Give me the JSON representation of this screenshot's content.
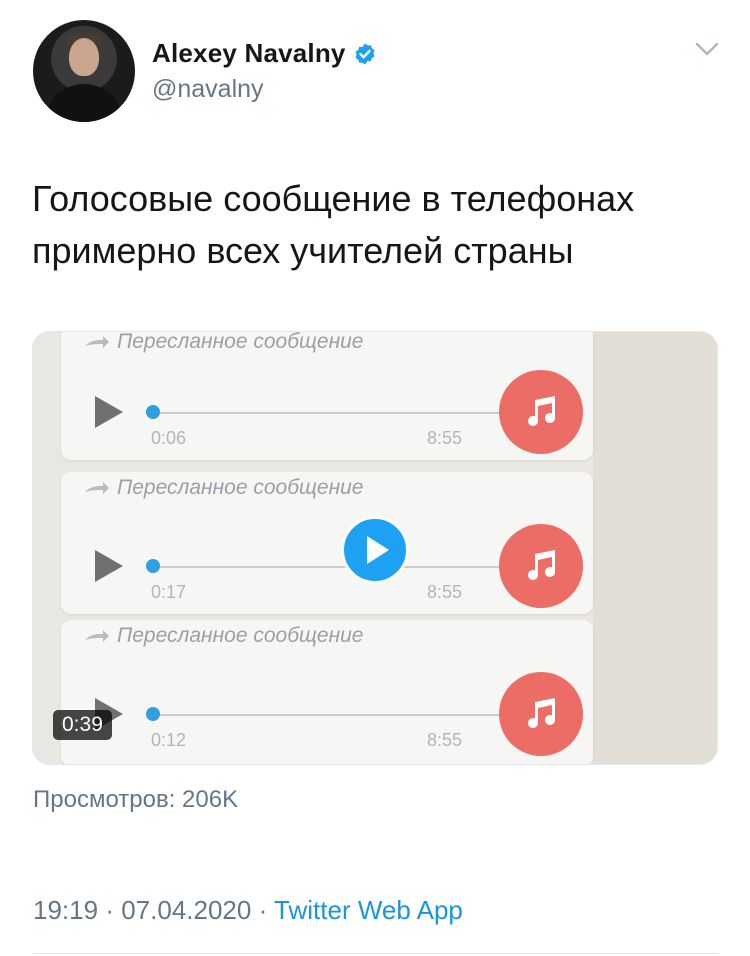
{
  "author": {
    "name": "Alexey Navalny",
    "handle": "@navalny",
    "verified": true
  },
  "tweet": {
    "line1": "Голосовые сообщение в телефонах",
    "line2": "примерно всех учителей страны"
  },
  "media": {
    "duration": "0:39",
    "messages": [
      {
        "forwarded_label": "Пересланное сообщение",
        "elapsed": "0:06",
        "total": "8:55"
      },
      {
        "forwarded_label": "Пересланное сообщение",
        "elapsed": "0:17",
        "total": "8:55"
      },
      {
        "forwarded_label": "Пересланное сообщение",
        "elapsed": "0:12",
        "total": "8:55"
      }
    ]
  },
  "stats": {
    "views_text": "Просмотров: 206K"
  },
  "meta": {
    "time": "19:19",
    "separator": "·",
    "date": "07.04.2020",
    "app": "Twitter Web App"
  },
  "icons": {
    "verified": "verified-badge-icon",
    "caret": "chevron-down-icon",
    "play": "play-icon",
    "music": "music-note-icon",
    "forward": "forward-arrow-icon"
  },
  "colors": {
    "link": "#1b95e0",
    "verified": "#1da1f2",
    "music_circle": "#ec6c66",
    "progress_dot": "#2f9fe0"
  }
}
